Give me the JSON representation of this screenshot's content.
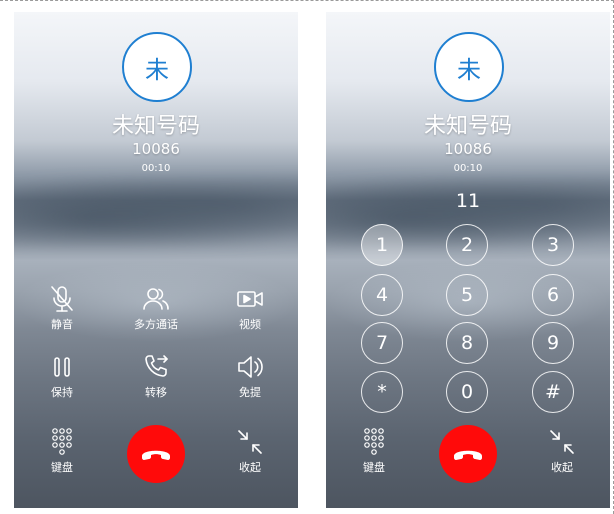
{
  "left_screen": {
    "avatar_char": "未",
    "caller_name": "未知号码",
    "caller_number": "10086",
    "call_timer": "00:10",
    "controls": {
      "mute": "静音",
      "conference": "多方通话",
      "video": "视频",
      "hold": "保持",
      "transfer": "转移",
      "speaker": "免提",
      "keypad": "键盘",
      "collapse": "收起"
    }
  },
  "right_screen": {
    "avatar_char": "未",
    "caller_name": "未知号码",
    "caller_number": "10086",
    "call_timer": "00:10",
    "dialed_digits": "11",
    "keys": [
      "1",
      "2",
      "3",
      "4",
      "5",
      "6",
      "7",
      "8",
      "9",
      "*",
      "0",
      "#"
    ],
    "pressed_key": "1",
    "controls": {
      "keypad": "键盘",
      "collapse": "收起"
    }
  },
  "icons": {
    "avatar": "contact-initial",
    "mute": "mic-off-icon",
    "conference": "people-icon",
    "video": "video-camera-icon",
    "hold": "pause-icon",
    "transfer": "phone-forward-icon",
    "speaker": "speaker-icon",
    "keypad": "dialpad-icon",
    "collapse": "collapse-arrows-icon",
    "hangup": "phone-hangup-icon"
  },
  "colors": {
    "accent": "#1f7fd1",
    "hangup": "#ff0a0a",
    "text": "#ffffff"
  }
}
